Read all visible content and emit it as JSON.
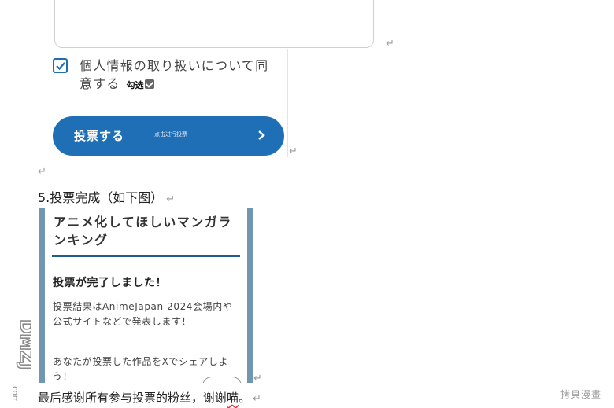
{
  "consent": {
    "text": "個人情報の取り扱いについて同意する",
    "annotation": "勾选"
  },
  "vote_button": {
    "label": "投票する",
    "annotation": "点击进行投票"
  },
  "step": {
    "heading": "5.投票完成（如下图）"
  },
  "result_screen": {
    "title": "アニメ化してほしいマンガランキング",
    "done": "投票が完了しました！",
    "message1": "投票結果はAnimeJapan 2024会場内や公式サイトなどで発表します！",
    "message2": "あなたが投票した作品をXでシェアしよう！"
  },
  "closing": {
    "before": "最后感谢所有参与投票的粉丝，谢谢",
    "squiggle": "喵",
    "after": "。"
  },
  "watermarks": {
    "left": "DMZJ.com",
    "right": "拷貝漫畫"
  },
  "colors": {
    "button": "#1f6fb7",
    "checkbox": "#1d6fb0",
    "frame": "#6f98b0",
    "rule": "#1a5f8f"
  },
  "icons": [
    "checkbox-checked-icon",
    "chevron-right-icon",
    "paragraph-return-icon"
  ]
}
